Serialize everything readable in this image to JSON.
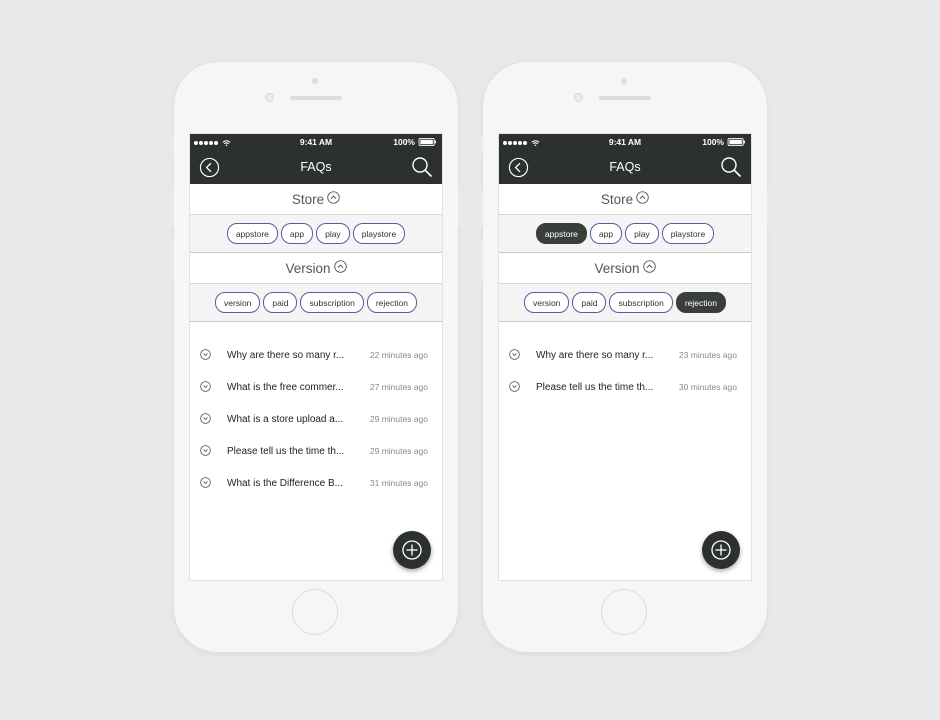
{
  "status": {
    "time": "9:41 AM",
    "battery": "100%"
  },
  "nav": {
    "title": "FAQs"
  },
  "icons": {
    "back": "chevron-left-circle-icon",
    "search": "search-icon",
    "section_toggle": "chevron-up-circle-icon",
    "item_toggle": "chevron-down-circle-icon",
    "fab": "plus-circle-icon"
  },
  "colors": {
    "bar": "#2d312d",
    "chip_border": "#5b5aa6",
    "chip_active": "#3a3e3a"
  },
  "phones": [
    {
      "sections": [
        {
          "title": "Store",
          "chips": [
            {
              "label": "appstore",
              "active": false
            },
            {
              "label": "app",
              "active": false
            },
            {
              "label": "play",
              "active": false
            },
            {
              "label": "playstore",
              "active": false
            }
          ]
        },
        {
          "title": "Version",
          "chips": [
            {
              "label": "version",
              "active": false
            },
            {
              "label": "paid",
              "active": false
            },
            {
              "label": "subscription",
              "active": false
            },
            {
              "label": "rejection",
              "active": false
            }
          ]
        }
      ],
      "faqs": [
        {
          "question": "Why are there so many r...",
          "time": "22 minutes ago"
        },
        {
          "question": "What is the free commer...",
          "time": "27 minutes ago"
        },
        {
          "question": "What is a store upload a...",
          "time": "29 minutes ago"
        },
        {
          "question": "Please tell us the time th...",
          "time": "29 minutes ago"
        },
        {
          "question": "What is the Difference B...",
          "time": "31 minutes ago"
        }
      ]
    },
    {
      "sections": [
        {
          "title": "Store",
          "chips": [
            {
              "label": "appstore",
              "active": true
            },
            {
              "label": "app",
              "active": false
            },
            {
              "label": "play",
              "active": false
            },
            {
              "label": "playstore",
              "active": false
            }
          ]
        },
        {
          "title": "Version",
          "chips": [
            {
              "label": "version",
              "active": false
            },
            {
              "label": "paid",
              "active": false
            },
            {
              "label": "subscription",
              "active": false
            },
            {
              "label": "rejection",
              "active": true
            }
          ]
        }
      ],
      "faqs": [
        {
          "question": "Why are there so many r...",
          "time": "23 minutes ago"
        },
        {
          "question": "Please tell us the time th...",
          "time": "30 minutes ago"
        }
      ]
    }
  ]
}
